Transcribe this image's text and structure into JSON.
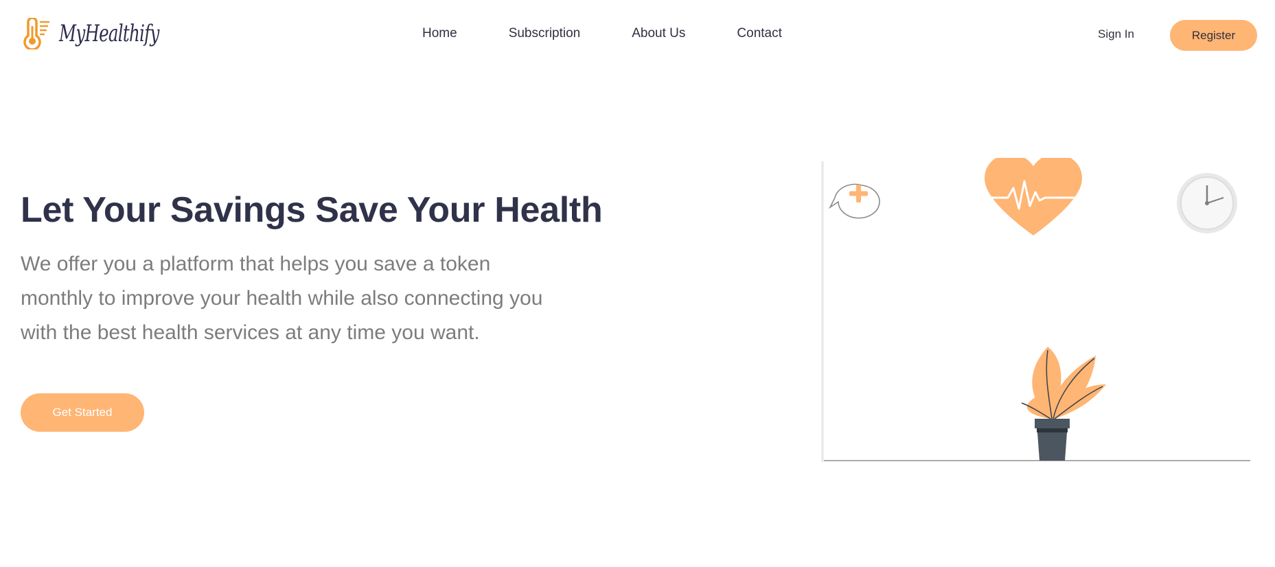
{
  "brand": {
    "name": "MyHealthify",
    "logo_icon": "thermometer-icon",
    "accent_color": "#ffb574",
    "text_dark": "#30324a"
  },
  "nav": {
    "items": [
      {
        "label": "Home"
      },
      {
        "label": "Subscription"
      },
      {
        "label": "About Us"
      },
      {
        "label": "Contact"
      }
    ]
  },
  "auth": {
    "sign_in_label": "Sign In",
    "register_label": "Register"
  },
  "hero": {
    "title": "Let Your Savings Save Your Health",
    "subtitle": "We offer you a platform that helps you save a token monthly to improve your health while also connecting you with the best health services at any time you want.",
    "cta_label": "Get Started"
  },
  "illustration": {
    "icons": [
      "medical-chat-bubble-icon",
      "heartbeat-heart-icon",
      "clock-icon",
      "potted-plant-icon"
    ]
  }
}
